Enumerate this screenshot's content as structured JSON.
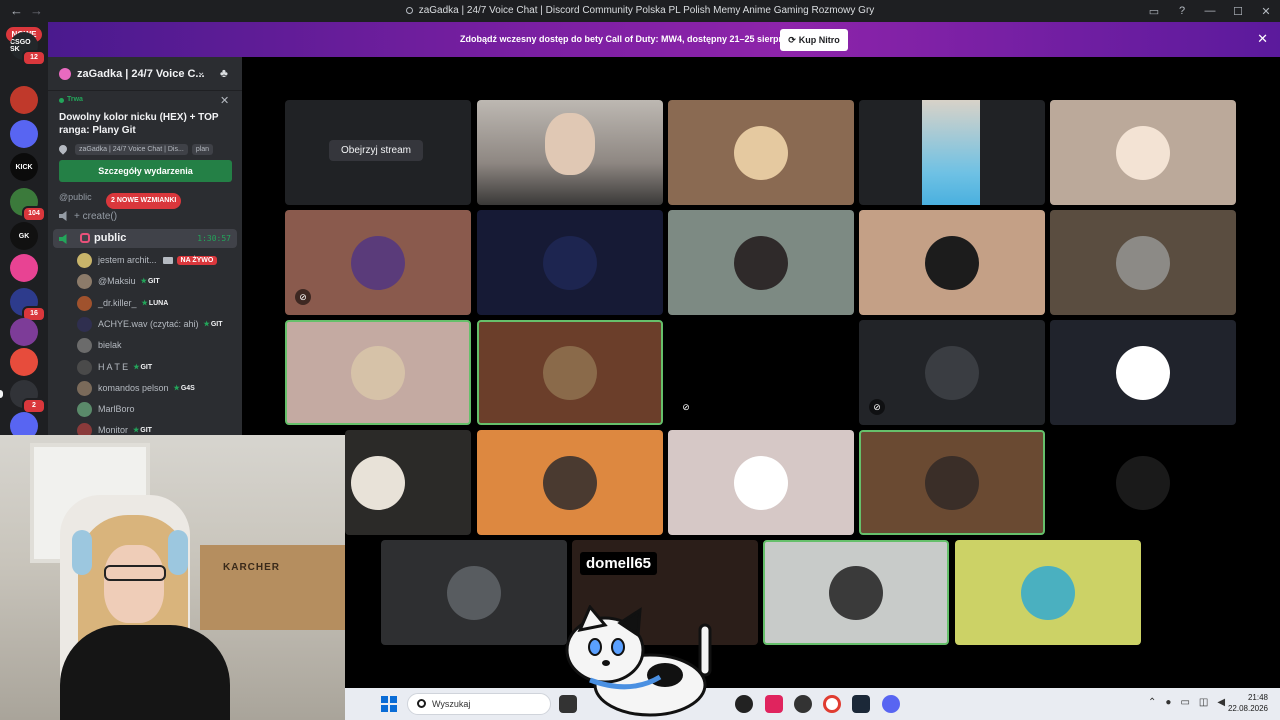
{
  "window": {
    "title": "zaGadka | 24/7 Voice Chat | Discord Community Polska PL Polish Memy Anime Gaming Rozmowy Gry",
    "back_glyph": "←",
    "forward_glyph": "→"
  },
  "rail": {
    "new_badge": "NOWE",
    "servers": [
      {
        "name": "CSGO SK",
        "badge": "12",
        "color": "#23272a"
      },
      {
        "name": "",
        "badge": "",
        "color": "#c0392b"
      },
      {
        "name": "",
        "badge": "",
        "color": "#5865f2"
      },
      {
        "name": "KICK",
        "badge": "",
        "color": "#0b0b0b"
      },
      {
        "name": "",
        "badge": "104",
        "color": "#3b7a3b"
      },
      {
        "name": "GK",
        "badge": "",
        "color": "#111111"
      },
      {
        "name": "",
        "badge": "",
        "color": "#e84393"
      },
      {
        "name": "",
        "badge": "16",
        "color": "#2d3b8c"
      },
      {
        "name": "",
        "badge": "",
        "color": "#7d3c98"
      },
      {
        "name": "",
        "badge": "",
        "color": "#e74c3c"
      },
      {
        "name": "",
        "badge": "2",
        "color": "#313338"
      },
      {
        "name": "",
        "badge": "",
        "color": "#5865f2"
      }
    ]
  },
  "banner": {
    "text": "Zdobądź wczesny dostęp do bety Call of Duty: MW4, dostępny 21–25 sierpnia.",
    "button": "Kup Nitro",
    "close": "✕"
  },
  "guild": {
    "name": "zaGadka | 24/7 Voice C...",
    "chevron": "⌄",
    "invite_icon": "♣"
  },
  "event": {
    "status": "Trwa",
    "title": "Dowolny kolor nicku (HEX) + TOP ranga: Plany Git",
    "location_chip": "zaGadka | 24/7 Voice Chat | Dis...",
    "location_chip2": "plan",
    "details_button": "Szczegóły wydarzenia",
    "close": "✕"
  },
  "channels": {
    "category": "@public",
    "mentions": "2 NOWE WZMIANKI",
    "create": "+ create()",
    "active": {
      "name": "public",
      "timer": "1:30:57"
    }
  },
  "users": [
    {
      "name": "jestem archit...",
      "tag": "",
      "live": "NA ŻYWO",
      "color": "#c8b46a"
    },
    {
      "name": "@Maksiu",
      "tag": "GIT",
      "live": "",
      "color": "#8c7b6a"
    },
    {
      "name": "_dr.killer_",
      "tag": "LUNA",
      "live": "",
      "color": "#a0522d"
    },
    {
      "name": "ACHYE.wav (czytać: ahi)",
      "tag": "GIT",
      "live": "",
      "color": "#2f2f4f"
    },
    {
      "name": "bielak",
      "tag": "",
      "live": "",
      "color": "#6b6b6b"
    },
    {
      "name": "H A T E",
      "tag": "GIT",
      "live": "",
      "color": "#4a4a4a"
    },
    {
      "name": "komandos pelson",
      "tag": "G4S",
      "live": "",
      "color": "#7a6a5a"
    },
    {
      "name": "MarlBoro",
      "tag": "",
      "live": "",
      "color": "#5a8a6a"
    },
    {
      "name": "Monitor",
      "tag": "GIT",
      "live": "",
      "color": "#8a3a3a"
    }
  ],
  "tiles": {
    "watch_stream": "Obejrzyj stream",
    "overlay_name": "domell65"
  },
  "webcam": {
    "box_label": "KARCHER"
  },
  "taskbar": {
    "search_placeholder": "Wyszukaj",
    "time": "21:48",
    "date": "22.08.2026"
  },
  "colors": {
    "discord_green": "#23a55a",
    "danger": "#da373c",
    "speaking_border": "#66c06b"
  }
}
